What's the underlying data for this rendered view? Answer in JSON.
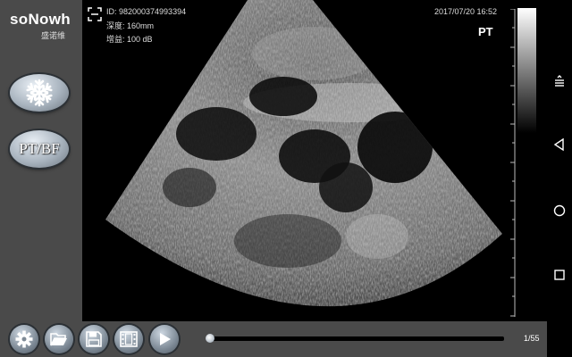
{
  "brand": {
    "logo_text": "soNowh",
    "logo_subtitle": "盛诺维"
  },
  "sidebar": {
    "freeze_icon": "snowflake-icon",
    "mode_toggle_label": "PT/BF"
  },
  "image_info": {
    "id": "ID: 982000374993394",
    "depth": "深度:  160mm",
    "gain": "增益:  100 dB",
    "datetime": "2017/07/20 16:52",
    "mode": "PT"
  },
  "toolbar": {
    "icons": [
      "gear-icon",
      "folder-icon",
      "floppy-disk-icon",
      "film-icon",
      "play-icon"
    ]
  },
  "playback": {
    "frame_counter": "1/55",
    "progress": 0.0
  },
  "navigation": {
    "icons": [
      "menu-icon",
      "back-icon",
      "home-icon",
      "recents-icon"
    ]
  },
  "colors": {
    "panel_gray": "#4a4a4a",
    "button_steel": "#a9b4bf",
    "background": "#000000"
  }
}
